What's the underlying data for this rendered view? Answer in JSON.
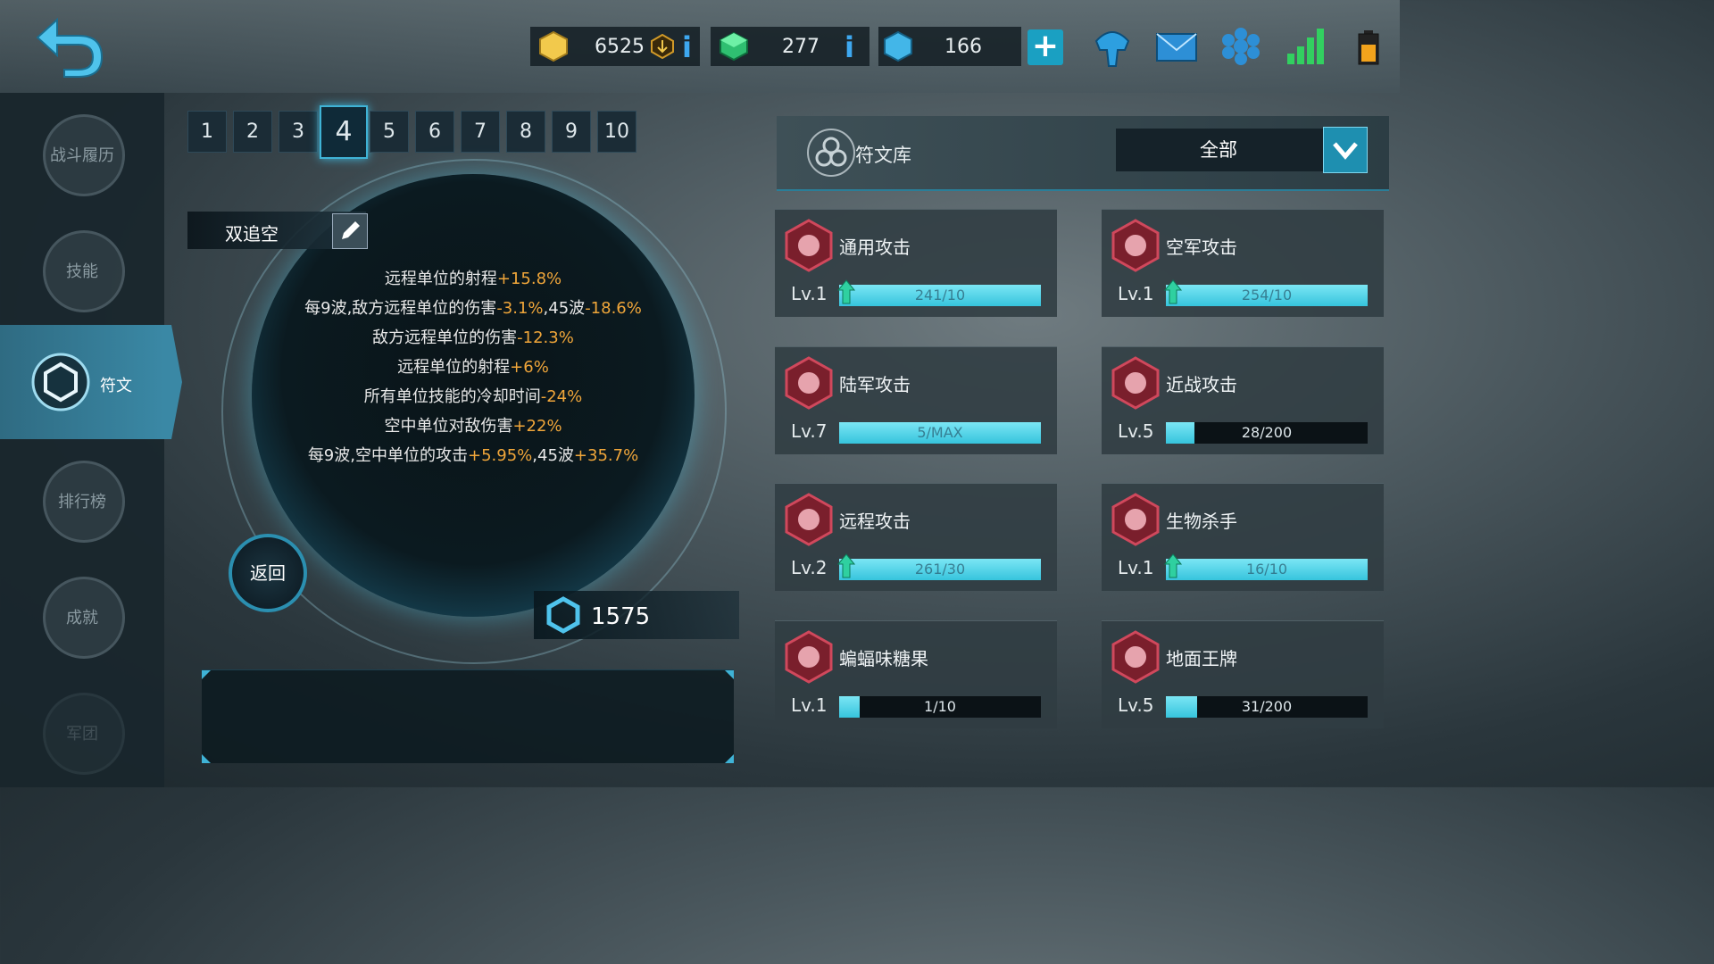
{
  "topbar": {
    "gold": "6525",
    "gems": "277",
    "crystals": "166"
  },
  "sidebar": {
    "items": [
      {
        "label": "战斗履历"
      },
      {
        "label": "技能"
      },
      {
        "label": "符文"
      },
      {
        "label": "排行榜"
      },
      {
        "label": "成就"
      },
      {
        "label": "军团"
      }
    ],
    "active_index": 2
  },
  "tabs": [
    "1",
    "2",
    "3",
    "4",
    "5",
    "6",
    "7",
    "8",
    "9",
    "10"
  ],
  "active_tab": "4",
  "rune_page": {
    "name": "双追空",
    "stats": [
      {
        "text": "远程单位的射程",
        "hl": "+15.8%",
        "rest": "",
        "hl2": ""
      },
      {
        "text": "每9波,敌方远程单位的伤害",
        "hl": "-3.1%",
        "rest": ",45波",
        "hl2": "-18.6%"
      },
      {
        "text": "敌方远程单位的伤害",
        "hl": "-12.3%",
        "rest": "",
        "hl2": ""
      },
      {
        "text": "远程单位的射程",
        "hl": "+6%",
        "rest": "",
        "hl2": ""
      },
      {
        "text": "所有单位技能的冷却时间",
        "hl": "-24%",
        "rest": "",
        "hl2": ""
      },
      {
        "text": "空中单位对敌伤害",
        "hl": "+22%",
        "rest": "",
        "hl2": ""
      },
      {
        "text": "每9波,空中单位的攻击",
        "hl": "+5.95%",
        "rest": ",45波",
        "hl2": "+35.7%"
      }
    ],
    "return_label": "返回",
    "cost": "1575"
  },
  "library": {
    "title": "符文库",
    "filter": "全部",
    "cards": [
      {
        "name": "通用攻击",
        "level": "Lv.1",
        "progress": "241/10",
        "fill": 1.0,
        "upgradable": true
      },
      {
        "name": "空军攻击",
        "level": "Lv.1",
        "progress": "254/10",
        "fill": 1.0,
        "upgradable": true
      },
      {
        "name": "陆军攻击",
        "level": "Lv.7",
        "progress": "5/MAX",
        "fill": 1.0,
        "upgradable": false
      },
      {
        "name": "近战攻击",
        "level": "Lv.5",
        "progress": "28/200",
        "fill": 0.14,
        "upgradable": false
      },
      {
        "name": "远程攻击",
        "level": "Lv.2",
        "progress": "261/30",
        "fill": 1.0,
        "upgradable": true
      },
      {
        "name": "生物杀手",
        "level": "Lv.1",
        "progress": "16/10",
        "fill": 1.0,
        "upgradable": true
      },
      {
        "name": "蝙蝠味糖果",
        "level": "Lv.1",
        "progress": "1/10",
        "fill": 0.1,
        "upgradable": false
      },
      {
        "name": "地面王牌",
        "level": "Lv.5",
        "progress": "31/200",
        "fill": 0.155,
        "upgradable": false
      }
    ]
  },
  "colors": {
    "accent": "#3fb3d6",
    "highlight": "#f0a63a",
    "rune_icon": "#c2344a"
  }
}
